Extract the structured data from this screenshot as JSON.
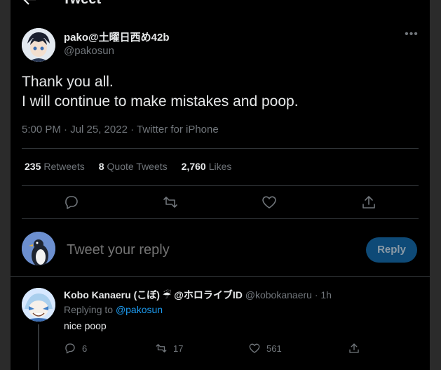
{
  "header": {
    "title": "Tweet"
  },
  "tweet": {
    "display_name": "pako@土曜日西め42b",
    "handle": "@pakosun",
    "text_lines": [
      "Thank you all.",
      "I will continue to make mistakes and poop."
    ],
    "meta": "5:00 PM · Jul 25, 2022 · Twitter for iPhone",
    "stats": {
      "retweets_count": "235",
      "retweets_label": "Retweets",
      "quotes_count": "8",
      "quotes_label": "Quote Tweets",
      "likes_count": "2,760",
      "likes_label": "Likes"
    }
  },
  "composer": {
    "placeholder": "Tweet your reply",
    "button": "Reply"
  },
  "reply": {
    "display_name": "Kobo Kanaeru (こぼ) ☔ @ホロライブID",
    "handle": "@kobokanaeru",
    "time": "· 1h",
    "replying_prefix": "Replying to",
    "replying_handle": "@pakosun",
    "text": "nice poop",
    "reply_count": "6",
    "retweet_count": "17",
    "like_count": "561"
  },
  "colors": {
    "accent": "#1d9bf0",
    "background": "#000000",
    "muted": "#71767b"
  }
}
